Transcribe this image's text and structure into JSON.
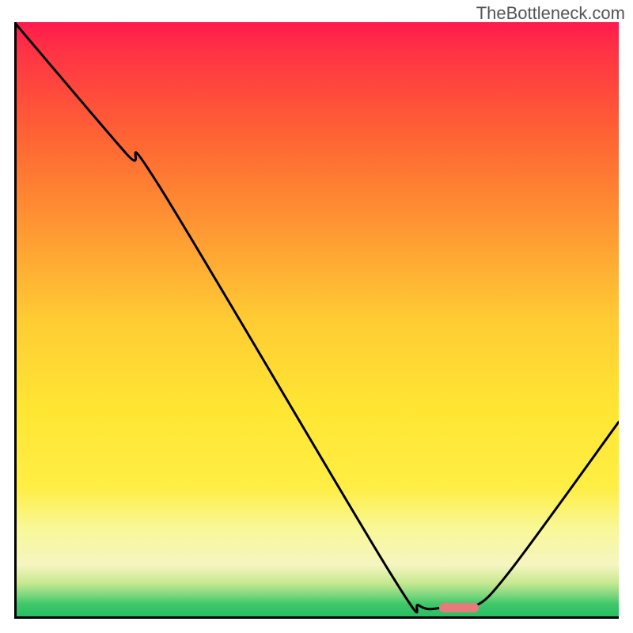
{
  "watermark": "TheBottleneck.com",
  "chart_data": {
    "type": "line",
    "title": "",
    "xlabel": "",
    "ylabel": "",
    "x_range_pct": [
      0,
      100
    ],
    "y_range_pct": [
      0,
      100
    ],
    "curve_points_pct": [
      {
        "x": 0.0,
        "y": 100.0
      },
      {
        "x": 18.5,
        "y": 78.0
      },
      {
        "x": 24.0,
        "y": 72.5
      },
      {
        "x": 62.0,
        "y": 8.0
      },
      {
        "x": 67.0,
        "y": 2.2
      },
      {
        "x": 71.0,
        "y": 1.8
      },
      {
        "x": 76.0,
        "y": 2.0
      },
      {
        "x": 82.0,
        "y": 8.0
      },
      {
        "x": 100.0,
        "y": 33.0
      }
    ],
    "marker": {
      "x_pct": 73.5,
      "y_pct": 1.8,
      "color": "#e77a7a"
    },
    "gradient_stops": [
      {
        "pct": 0,
        "color": "#ff1a4d"
      },
      {
        "pct": 50,
        "color": "#ffe633"
      },
      {
        "pct": 100,
        "color": "#26bd63"
      }
    ]
  }
}
